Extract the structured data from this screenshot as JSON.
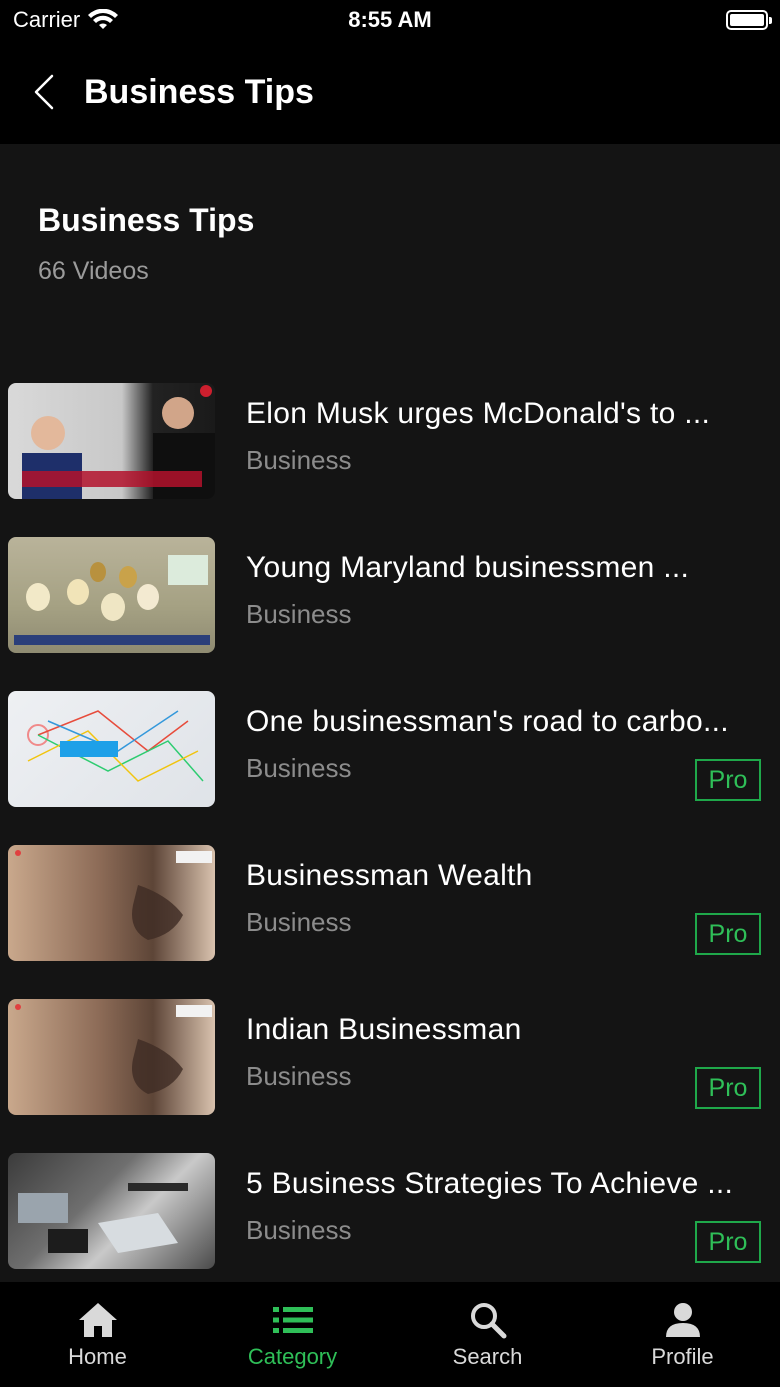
{
  "status_bar": {
    "carrier": "Carrier",
    "time": "8:55 AM"
  },
  "nav": {
    "title": "Business Tips",
    "back_icon": "chevron-left-icon"
  },
  "header": {
    "title": "Business Tips",
    "count": "66 Videos"
  },
  "items": [
    {
      "title": "Elon Musk urges McDonald's to ...",
      "category": "Business",
      "pro": ""
    },
    {
      "title": "Young Maryland businessmen ...",
      "category": "Business",
      "pro": ""
    },
    {
      "title": "One businessman's road to carbo...",
      "category": "Business",
      "pro": "Pro"
    },
    {
      "title": "Businessman Wealth",
      "category": "Business",
      "pro": "Pro"
    },
    {
      "title": "Indian Businessman",
      "category": "Business",
      "pro": "Pro"
    },
    {
      "title": "5 Business Strategies To Achieve ...",
      "category": "Business",
      "pro": "Pro"
    }
  ],
  "tabs": [
    {
      "label": "Home",
      "icon": "home-icon"
    },
    {
      "label": "Category",
      "icon": "list-icon"
    },
    {
      "label": "Search",
      "icon": "search-icon"
    },
    {
      "label": "Profile",
      "icon": "profile-icon"
    }
  ],
  "colors": {
    "accent": "#2fbf58",
    "background": "#141414"
  }
}
